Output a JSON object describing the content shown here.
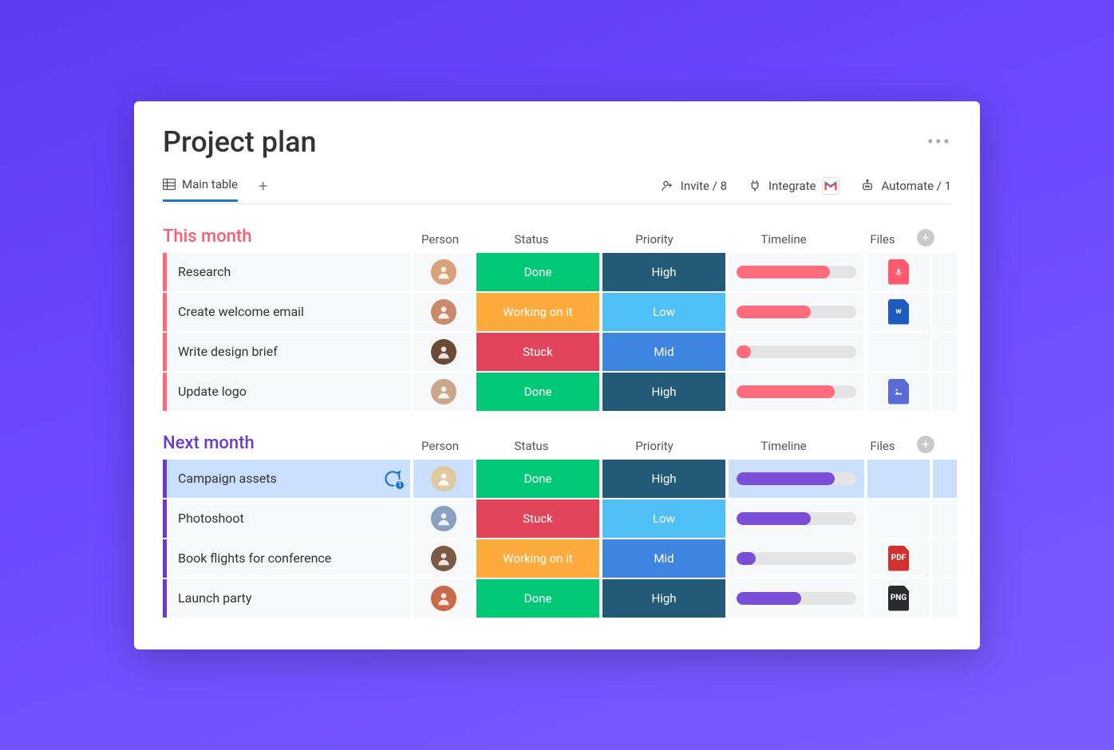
{
  "board": {
    "title": "Project plan"
  },
  "tabs": {
    "main": "Main table"
  },
  "toolbar": {
    "invite": "Invite / 8",
    "integrate": "Integrate",
    "automate": "Automate / 1"
  },
  "columns": {
    "person": "Person",
    "status": "Status",
    "priority": "Priority",
    "timeline": "Timeline",
    "files": "Files"
  },
  "groups": [
    {
      "title": "This month",
      "color": "pink",
      "rows": [
        {
          "task": "Research",
          "status": "Done",
          "priority": "High",
          "timeline_pct": 78,
          "file": {
            "type": "audio",
            "bg": "#ff5a6e",
            "label": ""
          },
          "avatar_bg": "#d9a07a",
          "selected": false,
          "chat": null
        },
        {
          "task": "Create welcome email",
          "status": "Working on it",
          "priority": "Low",
          "timeline_pct": 62,
          "file": {
            "type": "word",
            "bg": "#1d5bbf",
            "label": "w"
          },
          "avatar_bg": "#c98a6a",
          "selected": false,
          "chat": null
        },
        {
          "task": "Write design brief",
          "status": "Stuck",
          "priority": "Mid",
          "timeline_pct": 12,
          "file": null,
          "avatar_bg": "#6b4a35",
          "selected": false,
          "chat": null
        },
        {
          "task": "Update logo",
          "status": "Done",
          "priority": "High",
          "timeline_pct": 82,
          "file": {
            "type": "image",
            "bg": "#5b6bd6",
            "label": ""
          },
          "avatar_bg": "#c9a58a",
          "selected": false,
          "chat": null
        }
      ]
    },
    {
      "title": "Next month",
      "color": "purple",
      "rows": [
        {
          "task": "Campaign assets",
          "status": "Done",
          "priority": "High",
          "timeline_pct": 82,
          "file": null,
          "avatar_bg": "#e0c9a0",
          "selected": true,
          "chat": 1
        },
        {
          "task": "Photoshoot",
          "status": "Stuck",
          "priority": "Low",
          "timeline_pct": 62,
          "file": null,
          "avatar_bg": "#8aa0c0",
          "selected": false,
          "chat": null
        },
        {
          "task": "Book flights for conference",
          "status": "Working on it",
          "priority": "Mid",
          "timeline_pct": 16,
          "file": {
            "type": "pdf",
            "bg": "#d22f2f",
            "label": "PDF"
          },
          "avatar_bg": "#7a5a45",
          "selected": false,
          "chat": null
        },
        {
          "task": "Launch party",
          "status": "Done",
          "priority": "High",
          "timeline_pct": 54,
          "file": {
            "type": "png",
            "bg": "#2b2b2b",
            "label": "PNG"
          },
          "avatar_bg": "#c96a4a",
          "selected": false,
          "chat": null
        }
      ]
    }
  ],
  "colors": {
    "status": {
      "Done": "#00c875",
      "Working on it": "#fdab3d",
      "Stuck": "#e2445c"
    },
    "priority": {
      "High": "#225a78",
      "Mid": "#3d85e0",
      "Low": "#4ec0f5"
    }
  }
}
